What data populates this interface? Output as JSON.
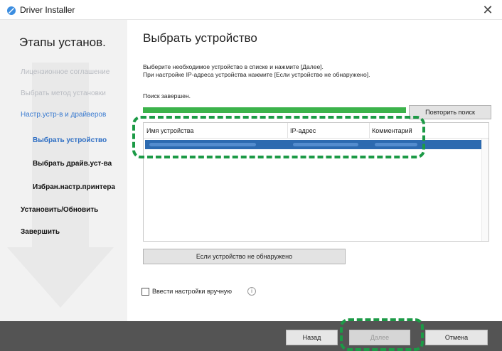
{
  "window": {
    "title": "Driver Installer"
  },
  "sidebar": {
    "title": "Этапы установ.",
    "steps": [
      {
        "label": "Лицензионное соглашение"
      },
      {
        "label": "Выбрать метод установки"
      },
      {
        "label": "Настр.устр-в и драйверов"
      },
      {
        "label": "Выбрать устройство"
      },
      {
        "label": "Выбрать драйв.уст-ва"
      },
      {
        "label": "Избран.настр.принтера"
      },
      {
        "label": "Установить/Обновить"
      },
      {
        "label": "Завершить"
      }
    ]
  },
  "main": {
    "title": "Выбрать устройство",
    "instruction_line1": "Выберите необходимое устройство в списке и нажмите [Далее].",
    "instruction_line2": "При настройке IP-адреса устройства нажмите [Если устройство не обнаружено].",
    "status": "Поиск завершен.",
    "progress_percent": 100,
    "retry_button": "Повторить поиск",
    "list": {
      "columns": [
        "Имя устройства",
        "IP-адрес",
        "Комментарий"
      ],
      "rows": [
        {
          "device_name": "",
          "ip": "",
          "comment": "",
          "selected": true
        }
      ]
    },
    "not_found_button": "Если устройство не обнаружено",
    "manual_label": "Ввести настройки вручную",
    "info_icon": "info-icon"
  },
  "footer": {
    "back": "Назад",
    "next": "Далее",
    "cancel": "Отмена"
  },
  "colors": {
    "accent_blue": "#2f6fc4",
    "selection": "#2c6ab0",
    "progress": "#3cb34b",
    "highlight": "#1c9a46",
    "footer": "#545454"
  }
}
